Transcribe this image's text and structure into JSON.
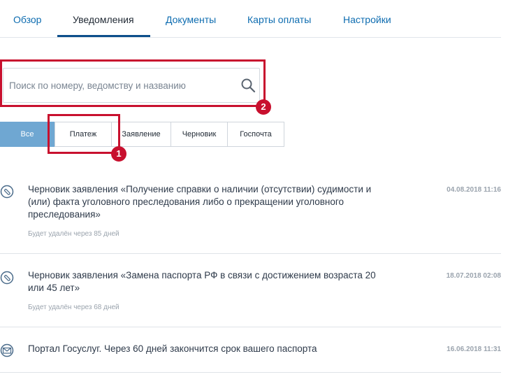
{
  "tabs": [
    {
      "label": "Обзор"
    },
    {
      "label": "Уведомления"
    },
    {
      "label": "Документы"
    },
    {
      "label": "Карты оплаты"
    },
    {
      "label": "Настройки"
    }
  ],
  "search": {
    "placeholder": "Поиск по номеру, ведомству и названию",
    "value": ""
  },
  "filters": [
    {
      "label": "Все"
    },
    {
      "label": "Платеж"
    },
    {
      "label": "Заявление"
    },
    {
      "label": "Черновик"
    },
    {
      "label": "Госпочта"
    }
  ],
  "annotations": {
    "badge1": "1",
    "badge2": "2",
    "color": "#c8102e"
  },
  "notifications": [
    {
      "icon": "draft-icon",
      "title": "Черновик заявления «Получение справки о наличии (отсутствии) судимости и (или) факта уголовного преследования либо о прекращении уголовного преследования»",
      "date": "04.08.2018 11:16",
      "sub": "Будет удалён через 85 дней"
    },
    {
      "icon": "draft-icon",
      "title": "Черновик заявления «Замена паспорта РФ в связи с достижением возраста 20 или 45 лет»",
      "date": "18.07.2018 02:08",
      "sub": "Будет удалён через 68 дней"
    },
    {
      "icon": "mail-icon",
      "title": "Портал Госуслуг. Через 60 дней закончится срок вашего паспорта",
      "date": "16.06.2018 11:31",
      "sub": ""
    }
  ]
}
